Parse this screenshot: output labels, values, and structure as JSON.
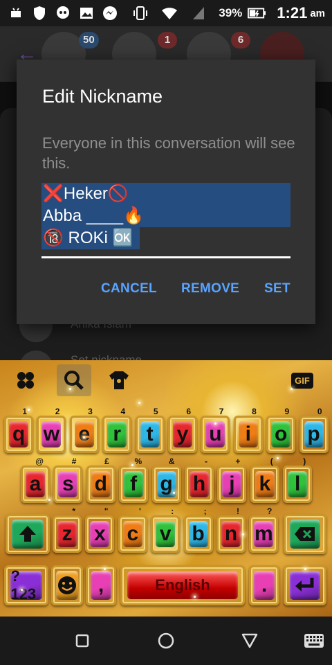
{
  "status_bar": {
    "battery_percent": "39%",
    "time": "1:21",
    "ampm": "am"
  },
  "background": {
    "badges": [
      "50",
      "1",
      "6"
    ],
    "rows": [
      "Anika Islam",
      "Set nickname"
    ]
  },
  "dialog": {
    "title": "Edit Nickname",
    "description": "Everyone in this conversation will see this.",
    "nickname_lines": [
      "❌Heker🚫",
      "Abba ____🔥",
      "🔞 ROKi 🆗"
    ],
    "buttons": {
      "cancel": "CANCEL",
      "remove": "REMOVE",
      "set": "SET"
    },
    "accent_color": "#5aa3ff",
    "selection_color": "#264d80"
  },
  "keyboard": {
    "toolbar": [
      "menu-icon",
      "search-icon",
      "theme-icon",
      "gif-icon"
    ],
    "gif_label": "GIF",
    "row1": [
      {
        "k": "q",
        "h": "1",
        "c": "#e8262e"
      },
      {
        "k": "w",
        "h": "2",
        "c": "#e83fb5"
      },
      {
        "k": "e",
        "h": "3",
        "c": "#f07c14"
      },
      {
        "k": "r",
        "h": "4",
        "c": "#2fc23a"
      },
      {
        "k": "t",
        "h": "5",
        "c": "#2db8e8"
      },
      {
        "k": "y",
        "h": "6",
        "c": "#e8262e"
      },
      {
        "k": "u",
        "h": "7",
        "c": "#e83fb5"
      },
      {
        "k": "i",
        "h": "8",
        "c": "#f07c14"
      },
      {
        "k": "o",
        "h": "9",
        "c": "#2fc23a"
      },
      {
        "k": "p",
        "h": "0",
        "c": "#2db8e8"
      }
    ],
    "row2": [
      {
        "k": "a",
        "h": "@",
        "c": "#e8262e"
      },
      {
        "k": "s",
        "h": "#",
        "c": "#e83fb5"
      },
      {
        "k": "d",
        "h": "£",
        "c": "#f07c14"
      },
      {
        "k": "f",
        "h": "%",
        "c": "#2fc23a"
      },
      {
        "k": "g",
        "h": "&",
        "c": "#2db8e8"
      },
      {
        "k": "h",
        "h": "-",
        "c": "#e8262e"
      },
      {
        "k": "j",
        "h": "+",
        "c": "#e83fb5"
      },
      {
        "k": "k",
        "h": "(",
        "c": "#f07c14"
      },
      {
        "k": "l",
        "h": ")",
        "c": "#2fc23a"
      }
    ],
    "row3": [
      {
        "k": "z",
        "h": "*",
        "c": "#e8262e"
      },
      {
        "k": "x",
        "h": "\"",
        "c": "#e83fb5"
      },
      {
        "k": "c",
        "h": "'",
        "c": "#f07c14"
      },
      {
        "k": "v",
        "h": ":",
        "c": "#2fc23a"
      },
      {
        "k": "b",
        "h": ";",
        "c": "#2db8e8"
      },
      {
        "k": "n",
        "h": "!",
        "c": "#e8262e"
      },
      {
        "k": "m",
        "h": "?",
        "c": "#e83fb5"
      }
    ],
    "shift_icon": "shift-arrow-icon",
    "backspace_icon": "backspace-icon",
    "symbols_label": "?123",
    "emoji_icon": "emoji-icon",
    "comma": ",",
    "space_label": "English",
    "period": ".",
    "enter_icon": "enter-icon"
  },
  "nav_bar": {
    "icons": [
      "recents-square-icon",
      "home-circle-icon",
      "back-triangle-icon",
      "keyboard-icon"
    ]
  }
}
